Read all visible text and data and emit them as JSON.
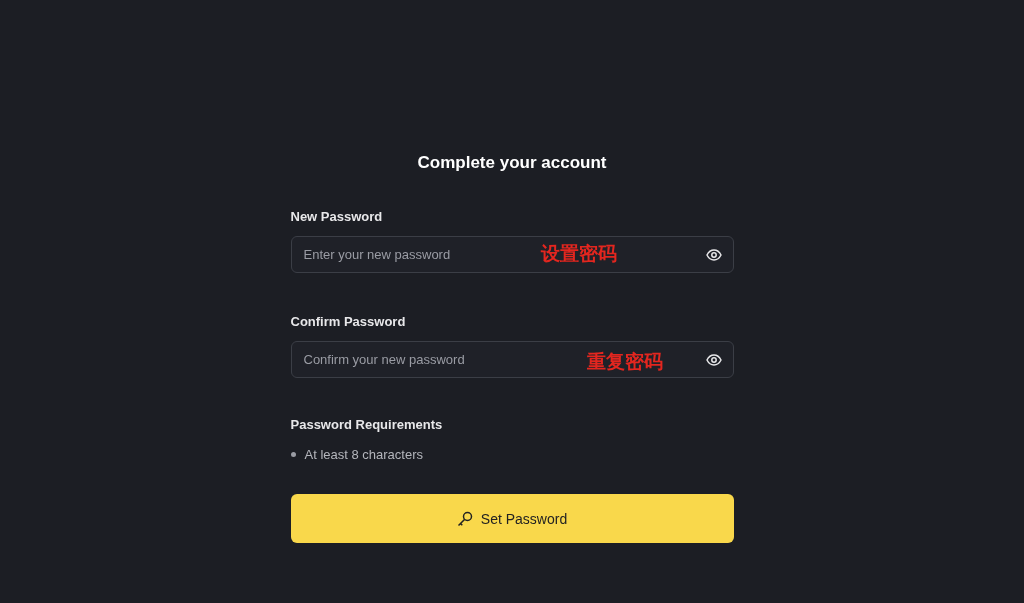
{
  "title": "Complete your account",
  "fields": [
    {
      "label": "New Password",
      "placeholder": "Enter your new password",
      "annotation": "设置密码"
    },
    {
      "label": "Confirm Password",
      "placeholder": "Confirm your new password",
      "annotation": "重复密码"
    }
  ],
  "requirements": {
    "heading": "Password Requirements",
    "items": [
      "At least 8 characters"
    ]
  },
  "button": {
    "label": "Set Password"
  }
}
